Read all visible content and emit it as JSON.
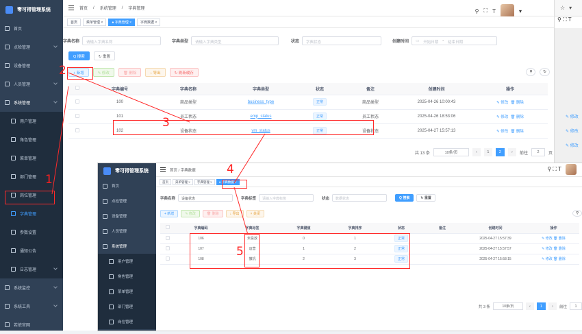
{
  "app": {
    "title": "零可得管理系统"
  },
  "sidebar": {
    "items": [
      {
        "label": "首页",
        "icon": "dashboard-icon"
      },
      {
        "label": "点检管理",
        "icon": "clipboard-icon"
      },
      {
        "label": "设备管理",
        "icon": "device-icon"
      },
      {
        "label": "人员管理",
        "icon": "user-icon"
      },
      {
        "label": "系统管理",
        "icon": "gear-icon"
      },
      {
        "label": "用户管理",
        "icon": "user-icon"
      },
      {
        "label": "角色管理",
        "icon": "role-icon"
      },
      {
        "label": "菜单管理",
        "icon": "menu-icon"
      },
      {
        "label": "部门管理",
        "icon": "tree-icon"
      },
      {
        "label": "岗位管理",
        "icon": "post-icon"
      },
      {
        "label": "字典管理",
        "icon": "dict-icon"
      },
      {
        "label": "参数设置",
        "icon": "edit-icon"
      },
      {
        "label": "通知公告",
        "icon": "message-icon"
      },
      {
        "label": "日志管理",
        "icon": "log-icon"
      },
      {
        "label": "系统监控",
        "icon": "monitor-icon"
      },
      {
        "label": "系统工具",
        "icon": "tool-icon"
      },
      {
        "label": "若依官网",
        "icon": "guide-icon"
      }
    ]
  },
  "topbar": {
    "home": "首页",
    "sep": "/",
    "crumb1": "系统管理",
    "crumb2": "字典管理"
  },
  "tags": [
    "首页",
    "菜单管理 ×",
    "● 字典管理 ×",
    "字典数据 ×"
  ],
  "search": {
    "name_label": "字典名称",
    "name_placeholder": "请输入字典名称",
    "type_label": "字典类型",
    "type_placeholder": "请输入字典类型",
    "status_label": "状态",
    "status_placeholder": "字典状态",
    "time_label": "创建时间",
    "start_placeholder": "开始日期",
    "dash": "-",
    "end_placeholder": "结束日期",
    "search_btn": "Q 搜索",
    "reset_btn": "↻ 重置"
  },
  "toolbar": {
    "add": "+ 新增",
    "edit": "✎ 修改",
    "delete": "🗑 删除",
    "export": "↓ 导出",
    "refresh": "↻ 刷新缓存"
  },
  "table": {
    "headers": [
      "字典编号",
      "字典名称",
      "字典类型",
      "状态",
      "备注",
      "创建时间",
      "操作"
    ],
    "rows": [
      {
        "id": "100",
        "name": "商品类型",
        "type": "business_type",
        "status": "正常",
        "remark": "商品类型",
        "time": "2025-04-26 10:00:43"
      },
      {
        "id": "101",
        "name": "员工状态",
        "type": "emp_status",
        "status": "正常",
        "remark": "员工状态",
        "time": "2025-04-26 18:53:06"
      },
      {
        "id": "102",
        "name": "设备状态",
        "type": "vm_status",
        "status": "正常",
        "remark": "设备状态",
        "time": "2025-04-27 15:57:13"
      }
    ],
    "edit_label": "✎ 修改",
    "delete_label": "🗑 删除"
  },
  "pager": {
    "total": "共 13 条",
    "size": "10条/页",
    "page1": "1",
    "page2": "2",
    "goto": "前往",
    "goto_val": "2",
    "page_unit": "页"
  },
  "right_frag": {
    "edit": "✎ 修改"
  },
  "annotations": [
    "1",
    "2",
    "3",
    "4",
    "5"
  ],
  "overlay": {
    "crumb": "首页 / 字典数据",
    "tags": [
      "首页",
      "菜单管理 ×",
      "字典管理 ×",
      "● 字典数据 ×"
    ],
    "search": {
      "name_label": "字典名称",
      "name_value": "设备状态",
      "label_label": "字典标签",
      "label_placeholder": "请输入字典标签",
      "status_label": "状态",
      "status_placeholder": "数据状态",
      "search_btn": "Q 搜索",
      "reset_btn": "↻ 重置"
    },
    "toolbar": {
      "add": "+ 新增",
      "edit": "✎ 修改",
      "delete": "🗑 删除",
      "export": "↓ 导出",
      "close": "× 关闭"
    },
    "headers": [
      "字典编码",
      "字典标签",
      "字典键值",
      "字典排序",
      "状态",
      "备注",
      "创建时间",
      "操作"
    ],
    "rows": [
      {
        "code": "106",
        "label": "未投放",
        "value": "0",
        "sort": "1",
        "status": "正常",
        "time": "2025-04-27 15:57:39"
      },
      {
        "code": "107",
        "label": "运营",
        "value": "1",
        "sort": "2",
        "status": "正常",
        "time": "2025-04-27 15:57:57"
      },
      {
        "code": "108",
        "label": "撤机",
        "value": "2",
        "sort": "3",
        "status": "正常",
        "time": "2025-04-27 15:58:15"
      }
    ],
    "pager": {
      "total": "共 3 条",
      "size": "10条/页",
      "page1": "1",
      "goto": "前往",
      "goto_val": "1"
    }
  },
  "colors": {
    "sidebar": "#304156",
    "primary": "#409eff",
    "annotation": "#ff1f1f"
  }
}
